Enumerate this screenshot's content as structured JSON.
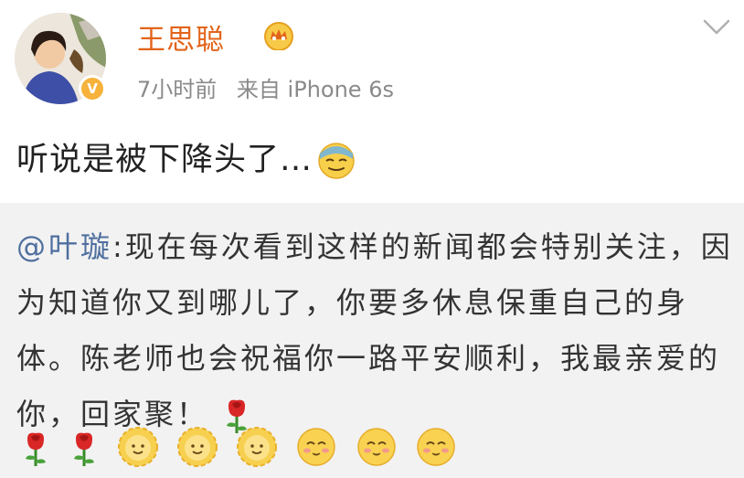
{
  "post": {
    "author": "王思聪",
    "time": "7小时前",
    "source": "来自 iPhone 6s",
    "verified_badge": "V",
    "text": "听说是被下降头了…",
    "icons": {
      "avatar": "avatar-image",
      "verified": "verified-badge-icon",
      "member": "crown-icon",
      "more": "chevron-down-icon",
      "emoji": "sweat-smile-emoji-icon"
    }
  },
  "retweet": {
    "mention": "@叶璇",
    "text": ":现在每次看到这样的新闻都会特别关注，因为知道你又到哪儿了，你要多休息保重自己的身体。陈老师也会祝福你一路平安顺利，我最亲爱的你，回家聚！",
    "emoji_row": [
      "rose-icon",
      "rose-icon",
      "sun-face-icon",
      "sun-face-icon",
      "sun-face-icon",
      "blush-face-icon",
      "blush-face-icon",
      "blush-face-icon"
    ]
  },
  "colors": {
    "author": "#e2641a",
    "mention": "#4f6f9f",
    "meta": "#8a8a8a",
    "retweet_bg": "#f2f2f2"
  }
}
